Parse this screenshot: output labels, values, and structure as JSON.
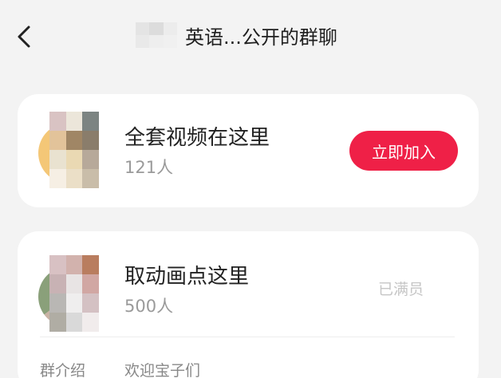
{
  "header": {
    "title": "英语...公开的群聊"
  },
  "groups": [
    {
      "name": "全套视频在这里",
      "member_count": "121人",
      "action_label": "立即加入",
      "avatar_colors": [
        "#f4c777",
        "#e8e2c8",
        "#9bb06a"
      ],
      "mosaic_colors": [
        "#d9c3c3",
        "#ece6da",
        "#7c8482",
        "#e2c39a",
        "#a08665",
        "#8a7d6b",
        "#e9e2d0",
        "#ead9b3",
        "#b7a99a",
        "#f6efe4",
        "#ebdfc7",
        "#c9bda9"
      ]
    },
    {
      "name": "取动画点这里",
      "member_count": "500人",
      "status_label": "已满员",
      "intro_label": "群介绍",
      "intro_text": "欢迎宝子们",
      "avatar_colors": [
        "#8aa07a",
        "#c9b3a5",
        "#6f8a5f"
      ],
      "mosaic_colors": [
        "#d8c1c3",
        "#d2b2ad",
        "#b97d5f",
        "#c8b2b4",
        "#e8e4e4",
        "#d1a7a3",
        "#b9b7b4",
        "#efeeee",
        "#d4c1c3",
        "#b0ada4",
        "#d9d9d9",
        "#f1ecec"
      ]
    }
  ],
  "colors": {
    "background": "#f3f3f3",
    "card": "#ffffff",
    "accent": "#ef2047",
    "muted_text": "#9a9a9a"
  },
  "icons": {
    "back": "chevron-left-icon"
  }
}
